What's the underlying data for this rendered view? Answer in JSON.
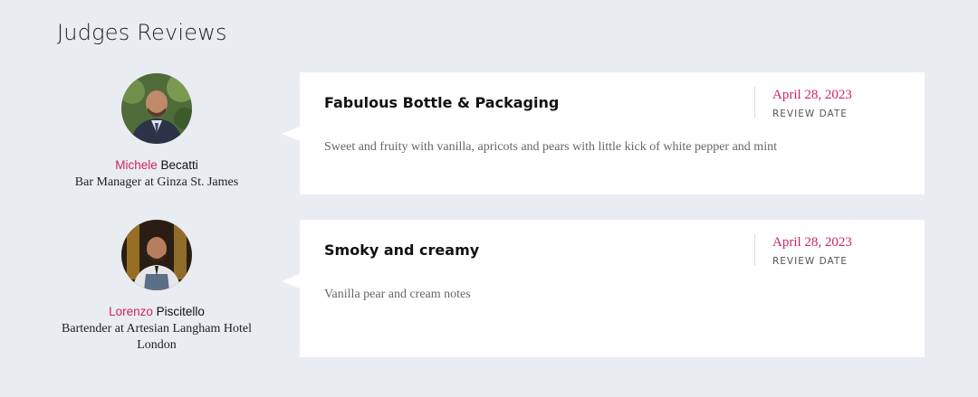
{
  "section": {
    "title": "Judges Reviews"
  },
  "reviews": [
    {
      "judge": {
        "first_name": "Michele",
        "last_name": "Becatti",
        "role": "Bar Manager at Ginza St. James"
      },
      "title": "Fabulous Bottle & Packaging",
      "text": "Sweet and fruity with vanilla, apricots and pears with little kick of white pepper and mint",
      "date": "April 28, 2023",
      "date_label": "REVIEW DATE"
    },
    {
      "judge": {
        "first_name": "Lorenzo",
        "last_name": "Piscitello",
        "role": "Bartender at Artesian Langham Hotel London"
      },
      "title": "Smoky and creamy",
      "text": "Vanilla pear and cream notes",
      "date": "April 28, 2023",
      "date_label": "REVIEW DATE"
    }
  ],
  "colors": {
    "accent": "#d1245c",
    "background": "#e9ecf1",
    "card": "#ffffff"
  }
}
